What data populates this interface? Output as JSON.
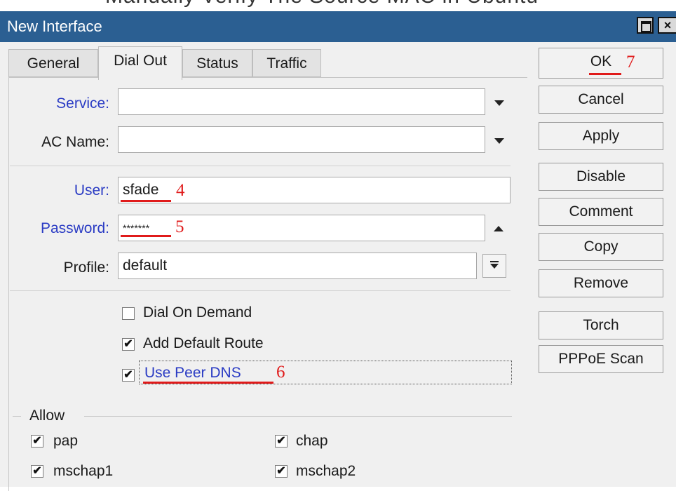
{
  "window": {
    "title": "New Interface"
  },
  "top_strip_text": "Manually Verify The Source MAC in Ubuntu",
  "tabs": [
    {
      "label": "General"
    },
    {
      "label": "Dial Out"
    },
    {
      "label": "Status"
    },
    {
      "label": "Traffic"
    }
  ],
  "active_tab": "Dial Out",
  "form": {
    "service_label": "Service:",
    "service_value": "",
    "ac_name_label": "AC Name:",
    "ac_name_value": "",
    "user_label": "User:",
    "user_value": "sfade",
    "password_label": "Password:",
    "password_value": "*******",
    "profile_label": "Profile:",
    "profile_value": "default"
  },
  "checkboxes": {
    "dial_on_demand": {
      "label": "Dial On Demand",
      "checked": false
    },
    "add_default_route": {
      "label": "Add Default Route",
      "checked": true
    },
    "use_peer_dns": {
      "label": "Use Peer DNS",
      "checked": true
    }
  },
  "allow": {
    "title": "Allow",
    "options": [
      {
        "label": "pap",
        "checked": true
      },
      {
        "label": "chap",
        "checked": true
      },
      {
        "label": "mschap1",
        "checked": true
      },
      {
        "label": "mschap2",
        "checked": true
      }
    ]
  },
  "buttons": {
    "ok": "OK",
    "cancel": "Cancel",
    "apply": "Apply",
    "disable": "Disable",
    "comment": "Comment",
    "copy": "Copy",
    "remove": "Remove",
    "torch": "Torch",
    "pppoe_scan": "PPPoE Scan"
  },
  "annotations": {
    "user_num": "4",
    "password_num": "5",
    "peer_dns_num": "6",
    "ok_num": "7"
  },
  "colors": {
    "titlebar": "#2b5f92",
    "label_blue": "#2b3cc4",
    "annotation_red": "#e01b1b",
    "window_bg": "#f0f0f0"
  }
}
